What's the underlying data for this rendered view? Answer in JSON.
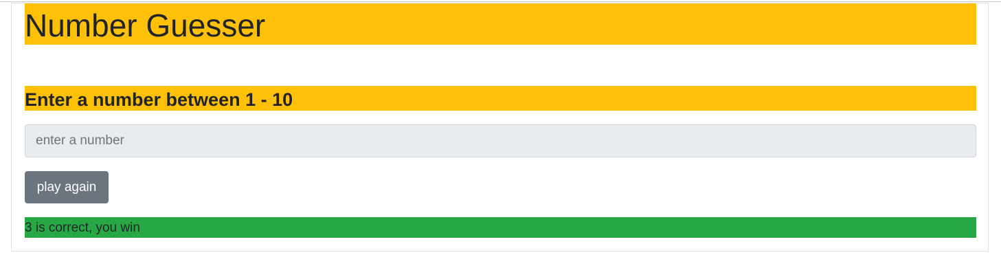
{
  "app": {
    "title": "Number Guesser",
    "prompt": "Enter a number between 1 - 10"
  },
  "guess_input": {
    "value": "",
    "placeholder": "enter a number"
  },
  "actions": {
    "play_again_label": "play again"
  },
  "status": {
    "message": "3 is correct, you win",
    "color": "#28a745"
  },
  "colors": {
    "accent": "#ffc107",
    "button": "#6c757d",
    "success": "#28a745"
  }
}
